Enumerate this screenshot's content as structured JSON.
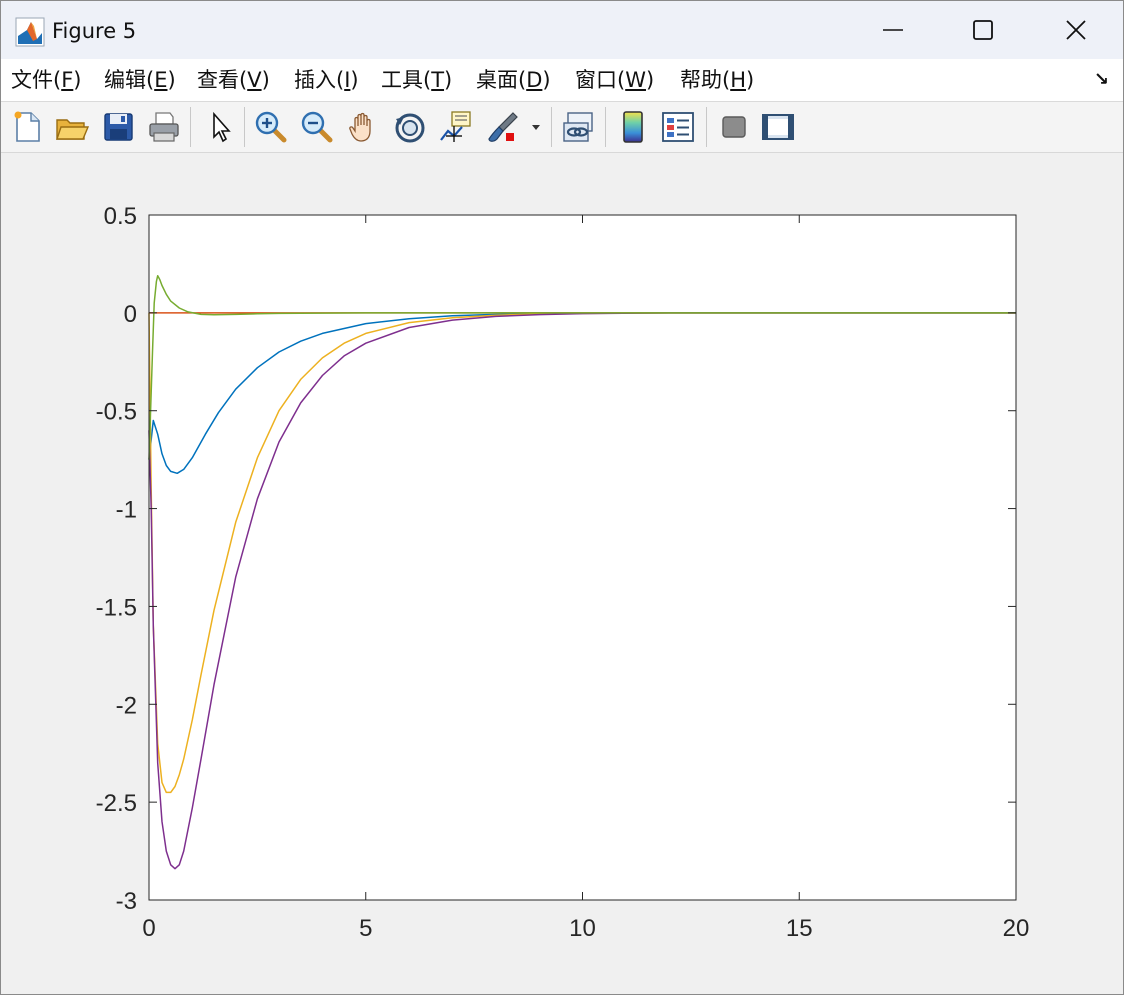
{
  "window": {
    "title": "Figure 5",
    "icons": {
      "app": "matlab-logo-icon",
      "minimize": "minimize-icon",
      "maximize": "maximize-icon",
      "close": "close-icon"
    }
  },
  "menu": {
    "items": [
      {
        "label": "文件(",
        "mnemonic": "F",
        "suffix": ")"
      },
      {
        "label": "编辑(",
        "mnemonic": "E",
        "suffix": ")"
      },
      {
        "label": "查看(",
        "mnemonic": "V",
        "suffix": ")"
      },
      {
        "label": "插入(",
        "mnemonic": "I",
        "suffix": ")"
      },
      {
        "label": "工具(",
        "mnemonic": "T",
        "suffix": ")"
      },
      {
        "label": "桌面(",
        "mnemonic": "D",
        "suffix": ")"
      },
      {
        "label": "窗口(",
        "mnemonic": "W",
        "suffix": ")"
      },
      {
        "label": "帮助(",
        "mnemonic": "H",
        "suffix": ")"
      }
    ],
    "dock_icon": "dock-arrow-icon",
    "dock_glyph": "↘"
  },
  "toolbar": {
    "tools": [
      "new-figure-icon",
      "open-file-icon",
      "save-icon",
      "print-icon",
      "select-arrow-icon",
      "zoom-in-icon",
      "zoom-out-icon",
      "pan-hand-icon",
      "rotate-3d-icon",
      "data-cursor-icon",
      "brush-icon",
      "brush-dropdown-icon",
      "link-plot-icon",
      "colorbar-icon",
      "legend-icon",
      "hide-plot-tools-icon",
      "show-plot-tools-icon"
    ]
  },
  "chart_data": {
    "type": "line",
    "title": "",
    "xlabel": "",
    "ylabel": "",
    "xlim": [
      0,
      20
    ],
    "ylim": [
      -3,
      0.5
    ],
    "xticks": [
      "0",
      "5",
      "10",
      "15",
      "20"
    ],
    "yticks": [
      "0.5",
      "0",
      "-0.5",
      "-1",
      "-1.5",
      "-2",
      "-2.5",
      "-3"
    ],
    "grid": false,
    "legend": "none",
    "series": [
      {
        "color": "#0072BD",
        "x": [
          0,
          0.1,
          0.2,
          0.3,
          0.4,
          0.5,
          0.65,
          0.8,
          1.0,
          1.3,
          1.6,
          2.0,
          2.5,
          3.0,
          3.5,
          4.0,
          5.0,
          6.0,
          7.0,
          8.0,
          9.0,
          10.0,
          12.0,
          15.0,
          20.0
        ],
        "y": [
          -0.75,
          -0.55,
          -0.62,
          -0.72,
          -0.78,
          -0.81,
          -0.82,
          -0.8,
          -0.74,
          -0.62,
          -0.51,
          -0.39,
          -0.28,
          -0.2,
          -0.145,
          -0.105,
          -0.055,
          -0.03,
          -0.015,
          -0.008,
          -0.004,
          -0.002,
          0,
          0,
          0
        ]
      },
      {
        "color": "#D95319",
        "x": [
          0,
          5,
          10,
          15,
          20
        ],
        "y": [
          0,
          0,
          0,
          0,
          0
        ]
      },
      {
        "color": "#EDB120",
        "x": [
          0,
          0.05,
          0.1,
          0.2,
          0.3,
          0.4,
          0.5,
          0.6,
          0.7,
          0.8,
          1.0,
          1.2,
          1.5,
          2.0,
          2.5,
          3.0,
          3.5,
          4.0,
          4.5,
          5.0,
          6.0,
          7.0,
          8.0,
          9.0,
          10.0,
          12.0,
          15.0,
          20.0
        ],
        "y": [
          0,
          -0.9,
          -1.6,
          -2.2,
          -2.4,
          -2.45,
          -2.45,
          -2.42,
          -2.36,
          -2.28,
          -2.08,
          -1.85,
          -1.52,
          -1.07,
          -0.74,
          -0.5,
          -0.34,
          -0.23,
          -0.155,
          -0.105,
          -0.05,
          -0.025,
          -0.012,
          -0.006,
          -0.003,
          0,
          0,
          0
        ]
      },
      {
        "color": "#7E2F8E",
        "x": [
          0,
          0.05,
          0.1,
          0.2,
          0.3,
          0.4,
          0.5,
          0.6,
          0.7,
          0.8,
          1.0,
          1.2,
          1.5,
          2.0,
          2.5,
          3.0,
          3.5,
          4.0,
          4.5,
          5.0,
          6.0,
          7.0,
          8.0,
          9.0,
          10.0,
          12.0,
          15.0,
          20.0
        ],
        "y": [
          -0.6,
          -1.0,
          -1.6,
          -2.3,
          -2.6,
          -2.75,
          -2.82,
          -2.84,
          -2.82,
          -2.75,
          -2.53,
          -2.28,
          -1.9,
          -1.35,
          -0.95,
          -0.66,
          -0.46,
          -0.32,
          -0.22,
          -0.155,
          -0.075,
          -0.037,
          -0.018,
          -0.009,
          -0.004,
          0,
          0,
          0
        ]
      },
      {
        "color": "#77AC30",
        "x": [
          0,
          0.08,
          0.12,
          0.17,
          0.2,
          0.25,
          0.3,
          0.4,
          0.5,
          0.7,
          0.9,
          1.2,
          1.5,
          2.0,
          2.5,
          3.0,
          4.0,
          5.0,
          10.0,
          15.0,
          20.0
        ],
        "y": [
          -0.75,
          -0.2,
          0.05,
          0.16,
          0.19,
          0.17,
          0.14,
          0.095,
          0.06,
          0.025,
          0.005,
          -0.008,
          -0.01,
          -0.008,
          -0.005,
          -0.003,
          -0.001,
          0,
          0,
          0,
          0
        ]
      }
    ]
  }
}
